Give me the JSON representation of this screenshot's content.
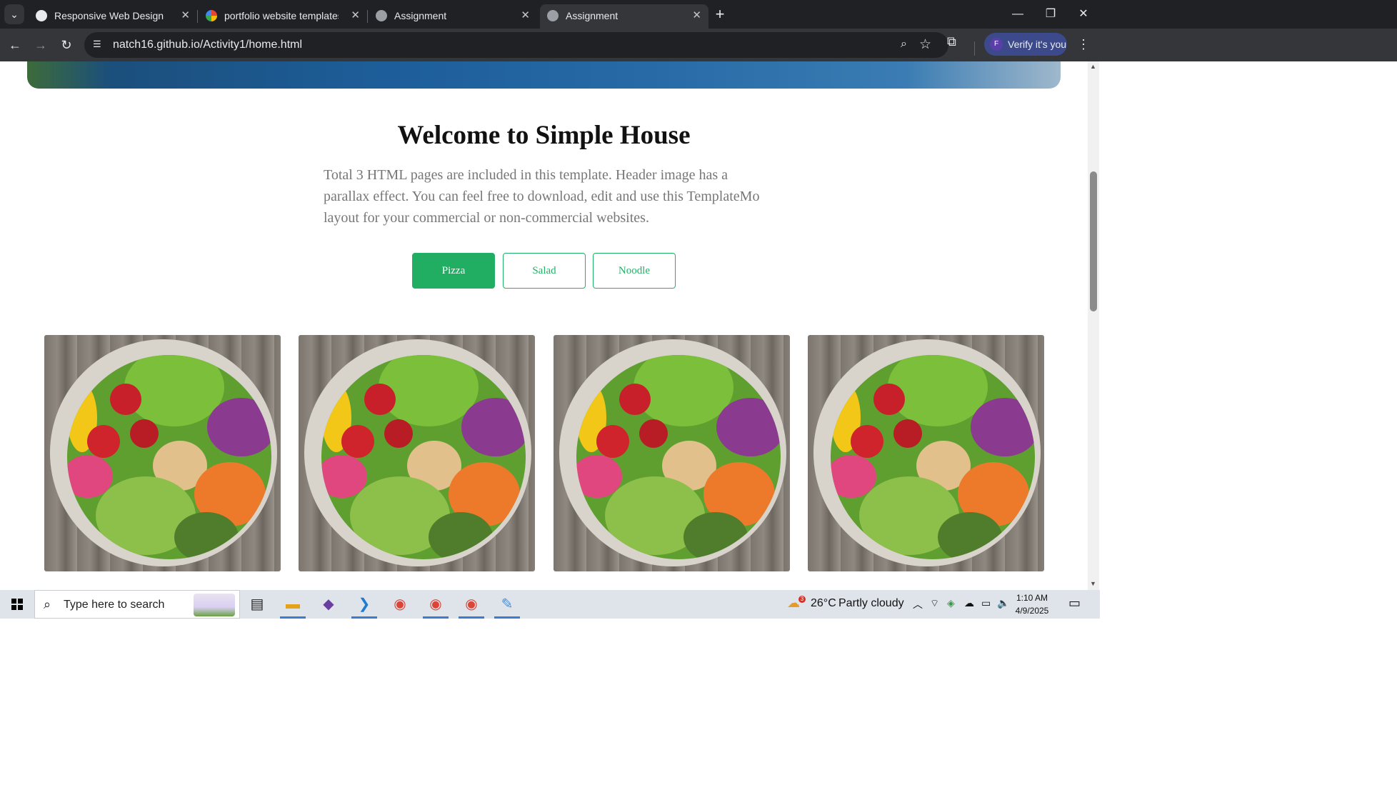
{
  "browser": {
    "tabs": [
      {
        "title": "Responsive Web Design",
        "active": false,
        "icon": "globe-icon"
      },
      {
        "title": "portfolio website templates - G",
        "active": false,
        "icon": "google-icon"
      },
      {
        "title": "Assignment",
        "active": false,
        "icon": "globe-icon"
      },
      {
        "title": "Assignment",
        "active": true,
        "icon": "globe-icon"
      }
    ],
    "url": "natch16.github.io/Activity1/home.html",
    "profile_button": "Verify it's you",
    "profile_initial": "F"
  },
  "page": {
    "heading": "Welcome to Simple House",
    "intro": "Total 3 HTML pages are included in this template. Header image has a parallax effect. You can feel free to download, edit and use this TemplateMo layout for your commercial or non-commercial websites.",
    "filters": [
      {
        "label": "Pizza",
        "active": true
      },
      {
        "label": "Salad",
        "active": false
      },
      {
        "label": "Noodle",
        "active": false
      }
    ],
    "gallery_count": 4,
    "accent_color": "#21ae62"
  },
  "taskbar": {
    "search_placeholder": "Type here to search",
    "weather_temp": "26°C",
    "weather_desc": "Partly cloudy",
    "weather_badge": "3",
    "time": "1:10 AM",
    "date": "4/9/2025"
  }
}
